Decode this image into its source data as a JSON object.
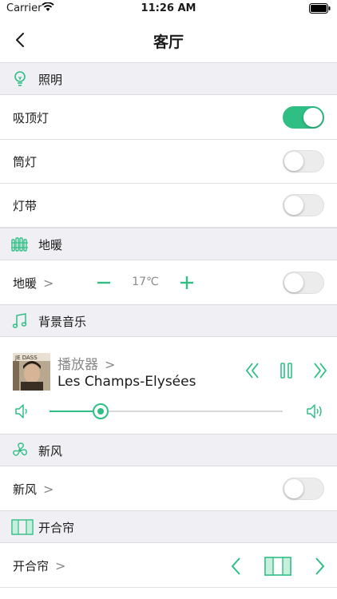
{
  "status_bar": {
    "carrier": "Carrier",
    "time": "11:26 AM"
  },
  "nav": {
    "title": "客厅"
  },
  "sections": {
    "lighting": {
      "title": "照明"
    },
    "floor_heating": {
      "title": "地暖"
    },
    "music": {
      "title": "背景音乐"
    },
    "fresh_air": {
      "title": "新风"
    },
    "curtain": {
      "title": "开合帘"
    }
  },
  "lights": [
    {
      "label": "吸顶灯",
      "on": true
    },
    {
      "label": "筒灯",
      "on": false
    },
    {
      "label": "灯带",
      "on": false
    }
  ],
  "floor_heating_row": {
    "label": "地暖",
    "chevron": ">",
    "temperature": "17℃",
    "on": false
  },
  "music_player": {
    "player_label": "播放器",
    "chevron": ">",
    "song": "Les Champs-Elysées",
    "volume_fraction": 0.22,
    "album_text": "JE DASS"
  },
  "fresh_air_row": {
    "label": "新风",
    "chevron": ">",
    "on": false
  },
  "curtain_row": {
    "label": "开合帘",
    "chevron": ">"
  },
  "colors": {
    "accent": "#2fbf85",
    "section_bg": "#efeff4",
    "toggle_off": "#ececed"
  }
}
